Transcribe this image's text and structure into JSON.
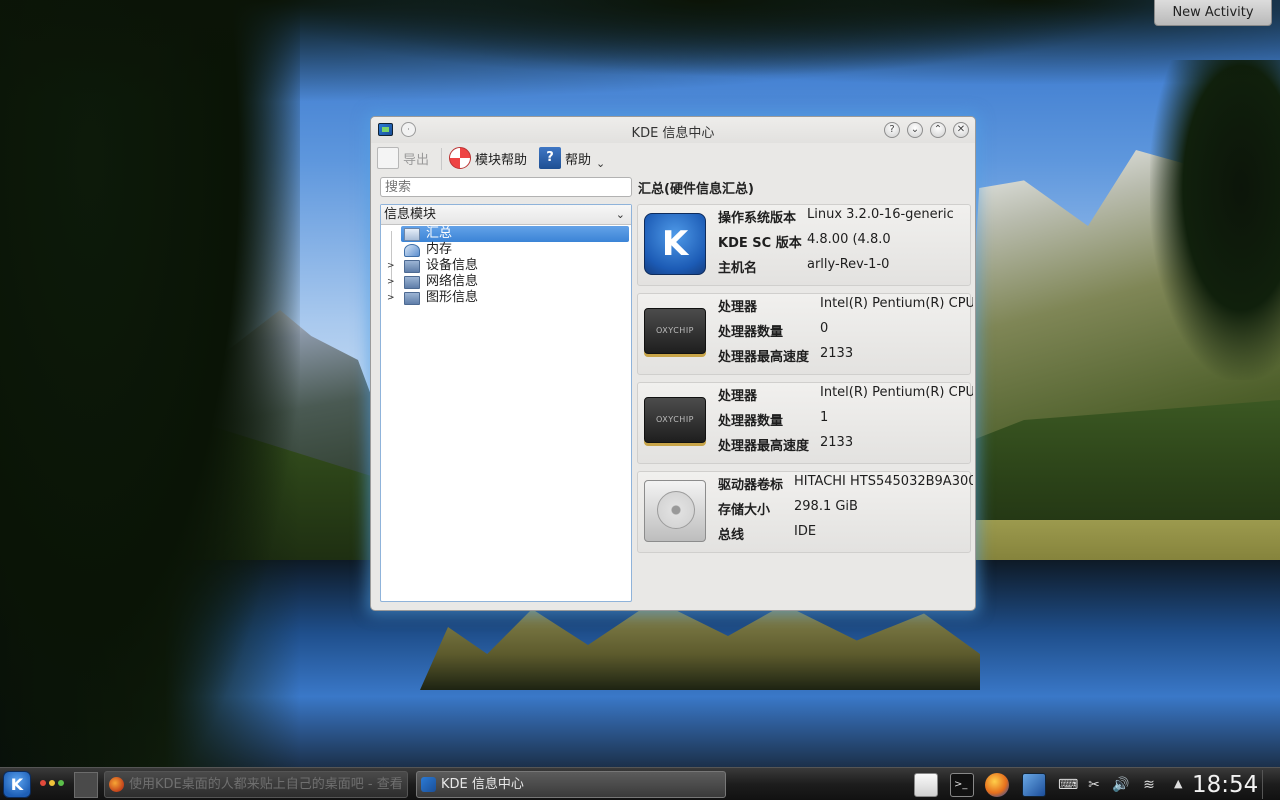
{
  "desktop": {
    "new_activity_label": "New Activity"
  },
  "window": {
    "title": "KDE 信息中心",
    "menu_button_glyph": "·",
    "buttons": {
      "help": "?",
      "minimize": "⌄",
      "maximize": "⌃",
      "close": "✕"
    }
  },
  "toolbar": {
    "export_label": "导出",
    "module_help_label": "模块帮助",
    "help_label": "帮助",
    "help_icon_glyph": "?",
    "help_dropdown_glyph": "⌄"
  },
  "search": {
    "placeholder": "搜索"
  },
  "module_combo": {
    "label": "信息模块",
    "arrow": "⌄"
  },
  "tree": [
    {
      "label": "汇总",
      "icon": "summary-icon",
      "expandable": false,
      "selected": true
    },
    {
      "label": "内存",
      "icon": "memory-icon",
      "expandable": false,
      "selected": false
    },
    {
      "label": "设备信息",
      "icon": "folder-icon",
      "expandable": true,
      "selected": false
    },
    {
      "label": "网络信息",
      "icon": "folder-icon",
      "expandable": true,
      "selected": false
    },
    {
      "label": "图形信息",
      "icon": "folder-icon",
      "expandable": true,
      "selected": false
    }
  ],
  "tree_expander_glyph": ">",
  "summary": {
    "title": "汇总(硬件信息汇总)",
    "os": {
      "logo_glyph": "K",
      "os_version_key": "操作系统版本",
      "os_version_value": "Linux 3.2.0-16-generic",
      "kde_version_key": "KDE SC 版本",
      "kde_version_value": "4.8.00 (4.8.0",
      "hostname_key": "主机名",
      "hostname_value": "arlly-Rev-1-0"
    },
    "cpus": [
      {
        "chip_label": "OXYCHIP",
        "processor_key": "处理器",
        "processor_value": "Intel(R) Pentium(R) CPU",
        "count_key": "处理器数量",
        "count_value": "0",
        "speed_key": "处理器最高速度",
        "speed_value": "2133"
      },
      {
        "chip_label": "OXYCHIP",
        "processor_key": "处理器",
        "processor_value": "Intel(R) Pentium(R) CPU",
        "count_key": "处理器数量",
        "count_value": "1",
        "speed_key": "处理器最高速度",
        "speed_value": "2133"
      }
    ],
    "drive": {
      "label_key": "驱动器卷标",
      "label_value": "HITACHI HTS545032B9A300",
      "size_key": "存储大小",
      "size_value": "298.1 GiB",
      "bus_key": "总线",
      "bus_value": "IDE"
    }
  },
  "scrollbar": {
    "left_arrow": "<",
    "right_arrow_dim": "<",
    "right_arrow": ">"
  },
  "taskbar": {
    "kmenu_glyph": "K",
    "task_1_label": "使用KDE桌面的人都来贴上自己的桌面吧 - 查看",
    "task_2_label": "KDE 信息中心",
    "terminal_glyph": ">_",
    "scissors_glyph": "✂",
    "volume_glyph": "🔊",
    "wifi_glyph": "≋",
    "keyboard_glyph": "⌨",
    "tray_caret_glyph": "▲",
    "clock": "18:54"
  },
  "colors": {
    "selection": "#3b84d6",
    "window_glow": "#50a0e6",
    "taskbar_bg": "#1d1d1d"
  }
}
